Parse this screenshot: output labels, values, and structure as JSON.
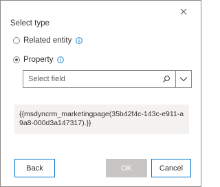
{
  "dialog": {
    "section_title": "Select type",
    "options": [
      {
        "label": "Related entity",
        "selected": false,
        "info_icon": "info-icon"
      },
      {
        "label": "Property",
        "selected": true,
        "info_icon": "info-icon"
      }
    ],
    "field": {
      "placeholder": "Select field",
      "value": "",
      "search_icon": "search-icon",
      "chevron_icon": "chevron-down-icon"
    },
    "expression": "{{msdyncrm_marketingpage(35b42f4c-143c-e911-a9a8-000d3a147317).}}",
    "buttons": {
      "back": "Back",
      "ok": "OK",
      "cancel": "Cancel"
    },
    "close_icon": "close-icon"
  },
  "colors": {
    "accent": "#0078d4",
    "border": "#8a8886",
    "disabled": "#c8c6c4",
    "panel": "#f3f2f1"
  }
}
